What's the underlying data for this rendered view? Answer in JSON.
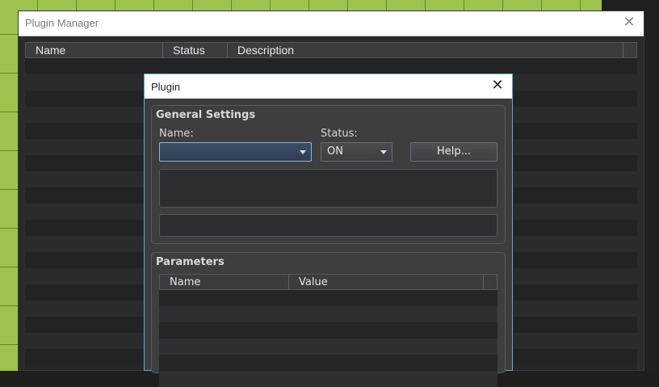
{
  "plugin_manager": {
    "title": "Plugin Manager",
    "close_glyph": "✕",
    "columns": {
      "name": "Name",
      "status": "Status",
      "description": "Description"
    },
    "row_count": 19
  },
  "plugin_dialog": {
    "title": "Plugin",
    "close_glyph": "✕",
    "general_settings": {
      "title": "General Settings",
      "name_label": "Name:",
      "name_value": "",
      "status_label": "Status:",
      "status_value": "ON",
      "help_button": "Help..."
    },
    "parameters": {
      "title": "Parameters",
      "columns": {
        "name": "Name",
        "value": "Value"
      },
      "row_count": 6
    }
  },
  "colors": {
    "accent_border": "#4fb3d9",
    "window_bg": "#3c3c3c",
    "list_bg": "#252525"
  }
}
